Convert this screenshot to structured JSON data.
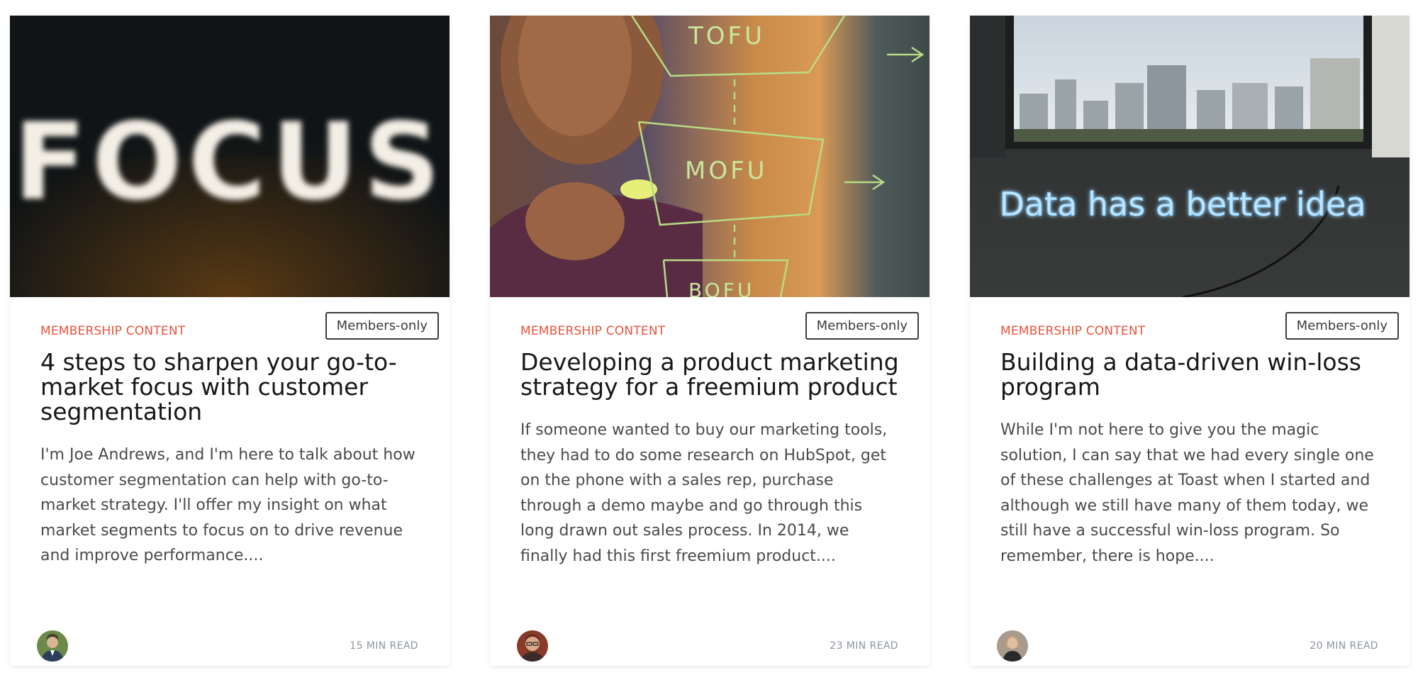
{
  "cards": [
    {
      "image_text": "FOCUS",
      "tag": "MEMBERSHIP CONTENT",
      "badge": "Members-only",
      "title": "4 steps to sharpen your go-to-market focus with customer segmentation",
      "excerpt": "I'm Joe Andrews, and I'm here to talk about how customer segmentation can help with go-to-market strategy. I'll offer my insight on what market segments to focus on to drive revenue and improve performance....",
      "reading_time": "15 MIN READ",
      "avatar_icon": "author-avatar"
    },
    {
      "image_text": [
        "TOFU",
        "MOFU",
        "BOFU"
      ],
      "tag": "MEMBERSHIP CONTENT",
      "badge": "Members-only",
      "title": "Developing a product marketing strategy for a freemium product",
      "excerpt": "If someone wanted to buy our marketing tools, they had to do some research on HubSpot, get on the phone with a sales rep, purchase through a demo maybe and go through this long drawn out sales process. In 2014, we finally had this first freemium product....",
      "reading_time": "23 MIN READ",
      "avatar_icon": "author-avatar"
    },
    {
      "image_text": "Data has a better idea",
      "tag": "MEMBERSHIP CONTENT",
      "badge": "Members-only",
      "title": "Building a data-driven win-loss program",
      "excerpt": "While I'm not here to give you the magic solution, I can say that we had every single one of these challenges at Toast when I started and although we still have many of them today, we still have a successful win-loss program. So remember, there is hope....",
      "reading_time": "20 MIN READ",
      "avatar_icon": "author-avatar"
    }
  ],
  "colors": {
    "tag": "#e8533b",
    "title": "#15171a",
    "excerpt": "#4a4a4a",
    "meta": "#8e959c"
  }
}
